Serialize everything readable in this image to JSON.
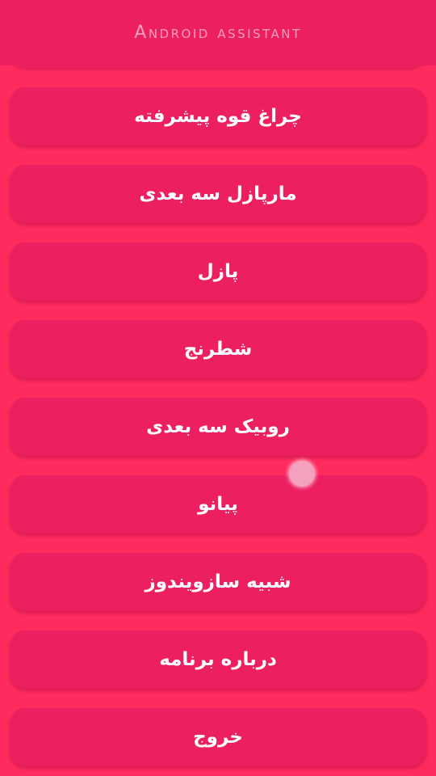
{
  "appbar": {
    "title": "Android assistant"
  },
  "menu": {
    "items": [
      {
        "label": "چراغ قوه پیشرفته"
      },
      {
        "label": "مارپازل سه بعدی"
      },
      {
        "label": "پازل"
      },
      {
        "label": "شطرنج"
      },
      {
        "label": "روبیک سه بعدی"
      },
      {
        "label": "پیانو"
      },
      {
        "label": "شبیه سازویندوز"
      },
      {
        "label": "درباره برنامه"
      },
      {
        "label": "خروج"
      }
    ]
  },
  "colors": {
    "background": "#ff2a5e",
    "appbar": "#ec1f61",
    "button": "#ec1f61",
    "title_text": "#ff9ec0",
    "button_text": "#ffffff",
    "touch_indicator": "#f4a0bf"
  }
}
